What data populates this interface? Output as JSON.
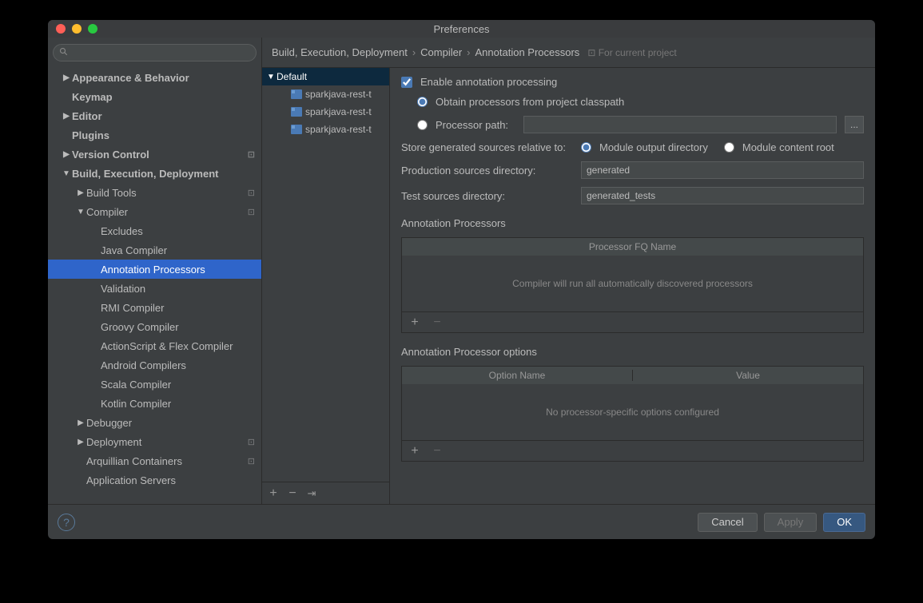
{
  "window": {
    "title": "Preferences"
  },
  "sidebar": {
    "search_placeholder": "",
    "items": [
      {
        "label": "Appearance & Behavior",
        "indent": 1,
        "arrow": "▶",
        "bold": true
      },
      {
        "label": "Keymap",
        "indent": 1,
        "arrow": "",
        "bold": true
      },
      {
        "label": "Editor",
        "indent": 1,
        "arrow": "▶",
        "bold": true
      },
      {
        "label": "Plugins",
        "indent": 1,
        "arrow": "",
        "bold": true
      },
      {
        "label": "Version Control",
        "indent": 1,
        "arrow": "▶",
        "bold": true,
        "badge": "⊡"
      },
      {
        "label": "Build, Execution, Deployment",
        "indent": 1,
        "arrow": "▼",
        "bold": true
      },
      {
        "label": "Build Tools",
        "indent": 2,
        "arrow": "▶",
        "bold": false,
        "badge": "⊡"
      },
      {
        "label": "Compiler",
        "indent": 2,
        "arrow": "▼",
        "bold": false,
        "badge": "⊡"
      },
      {
        "label": "Excludes",
        "indent": 3,
        "arrow": "",
        "bold": false
      },
      {
        "label": "Java Compiler",
        "indent": 3,
        "arrow": "",
        "bold": false
      },
      {
        "label": "Annotation Processors",
        "indent": 3,
        "arrow": "",
        "bold": false,
        "sel": true
      },
      {
        "label": "Validation",
        "indent": 3,
        "arrow": "",
        "bold": false
      },
      {
        "label": "RMI Compiler",
        "indent": 3,
        "arrow": "",
        "bold": false
      },
      {
        "label": "Groovy Compiler",
        "indent": 3,
        "arrow": "",
        "bold": false
      },
      {
        "label": "ActionScript & Flex Compiler",
        "indent": 3,
        "arrow": "",
        "bold": false
      },
      {
        "label": "Android Compilers",
        "indent": 3,
        "arrow": "",
        "bold": false
      },
      {
        "label": "Scala Compiler",
        "indent": 3,
        "arrow": "",
        "bold": false
      },
      {
        "label": "Kotlin Compiler",
        "indent": 3,
        "arrow": "",
        "bold": false
      },
      {
        "label": "Debugger",
        "indent": 2,
        "arrow": "▶",
        "bold": false
      },
      {
        "label": "Deployment",
        "indent": 2,
        "arrow": "▶",
        "bold": false,
        "badge": "⊡"
      },
      {
        "label": "Arquillian Containers",
        "indent": 2,
        "arrow": "",
        "bold": false,
        "badge": "⊡"
      },
      {
        "label": "Application Servers",
        "indent": 2,
        "arrow": "",
        "bold": false
      }
    ]
  },
  "breadcrumb": {
    "parts": [
      "Build, Execution, Deployment",
      "Compiler",
      "Annotation Processors"
    ],
    "suffix": "For current project"
  },
  "profiles": {
    "items": [
      {
        "label": "Default",
        "type": "profile",
        "sel": true
      },
      {
        "label": "sparkjava-rest-t",
        "type": "module"
      },
      {
        "label": "sparkjava-rest-t",
        "type": "module"
      },
      {
        "label": "sparkjava-rest-t",
        "type": "module"
      }
    ]
  },
  "settings": {
    "enable_label": "Enable annotation processing",
    "obtain_label": "Obtain processors from project classpath",
    "processor_path_label": "Processor path:",
    "processor_path_value": "",
    "store_label": "Store generated sources relative to:",
    "store_opt1": "Module output directory",
    "store_opt2": "Module content root",
    "prod_dir_label": "Production sources directory:",
    "prod_dir_value": "generated",
    "test_dir_label": "Test sources directory:",
    "test_dir_value": "generated_tests",
    "ap_section": "Annotation Processors",
    "ap_col": "Processor FQ Name",
    "ap_empty": "Compiler will run all automatically discovered processors",
    "opt_section": "Annotation Processor options",
    "opt_col1": "Option Name",
    "opt_col2": "Value",
    "opt_empty": "No processor-specific options configured"
  },
  "footer": {
    "cancel": "Cancel",
    "apply": "Apply",
    "ok": "OK"
  }
}
